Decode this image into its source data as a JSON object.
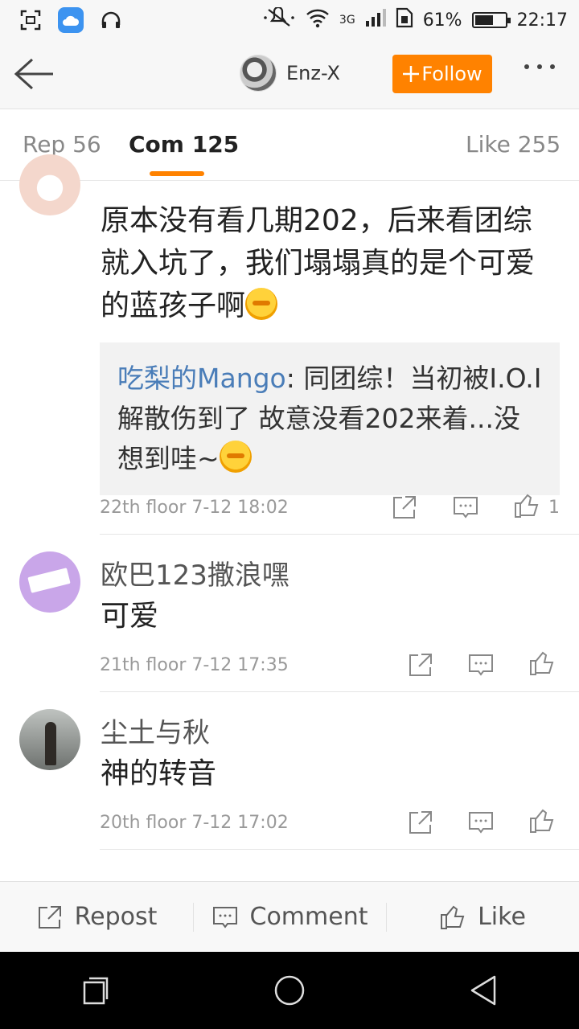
{
  "status_bar": {
    "network": "3G",
    "battery": "61%",
    "battery_level": 0.61,
    "time": "22:17"
  },
  "header": {
    "user_name": "Enz-X",
    "follow_label": "Follow"
  },
  "tabs": [
    {
      "label": "Rep 56"
    },
    {
      "label": "Com 125"
    },
    {
      "label": "Like 255"
    }
  ],
  "comments": [
    {
      "text": "原本没有看几期202，后来看团综就入坑了，我们塌塌真的是个可爱的蓝孩子啊",
      "reply_name": "吃梨的Mango",
      "reply_text": ": 同团综！当初被I.O.I解散伤到了 故意没看202来着...没想到哇~",
      "meta": "22th floor 7-12 18:02",
      "likes": "1"
    },
    {
      "name": "欧巴123撒浪嘿",
      "text": "可爱",
      "meta": "21th floor 7-12 17:35"
    },
    {
      "name": "尘土与秋",
      "text": "神的转音",
      "meta": "20th floor 7-12 17:02"
    }
  ],
  "bottom_bar": {
    "repost": "Repost",
    "comment": "Comment",
    "like": "Like"
  },
  "colors": {
    "accent": "#ff8200",
    "link": "#4a7db8"
  }
}
